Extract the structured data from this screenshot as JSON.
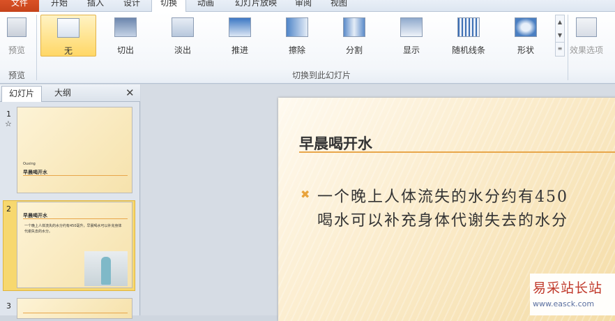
{
  "tabs": [
    "文件",
    "开始",
    "插入",
    "设计",
    "切换",
    "动画",
    "幻灯片放映",
    "审阅",
    "视图"
  ],
  "ribbon": {
    "preview": {
      "label": "预览",
      "group": "预览"
    },
    "transitions": [
      "无",
      "切出",
      "淡出",
      "推进",
      "擦除",
      "分割",
      "显示",
      "随机线条",
      "形状"
    ],
    "group_label": "切换到此幻灯片",
    "effect_options": "效果选项"
  },
  "panel": {
    "tab_slides": "幻灯片",
    "tab_outline": "大纲",
    "close": "✕",
    "thumbs": [
      {
        "num": "1",
        "star": "☆",
        "small": "Ouxing",
        "title": "早晨喝开水"
      },
      {
        "num": "2",
        "title": "早晨喝开水",
        "body": "一个晚上人体流失的水分约有450毫升，早晨喝水可以补充身体代谢失去的水分。"
      },
      {
        "num": "3"
      }
    ]
  },
  "slide": {
    "title": "早晨喝开水",
    "bullet_line1": "一个晚上人体流失的水分约有450",
    "bullet_line2": "喝水可以补充身体代谢失去的水分"
  },
  "watermark": {
    "text": "易采站长站",
    "url": "www.easck.com"
  }
}
